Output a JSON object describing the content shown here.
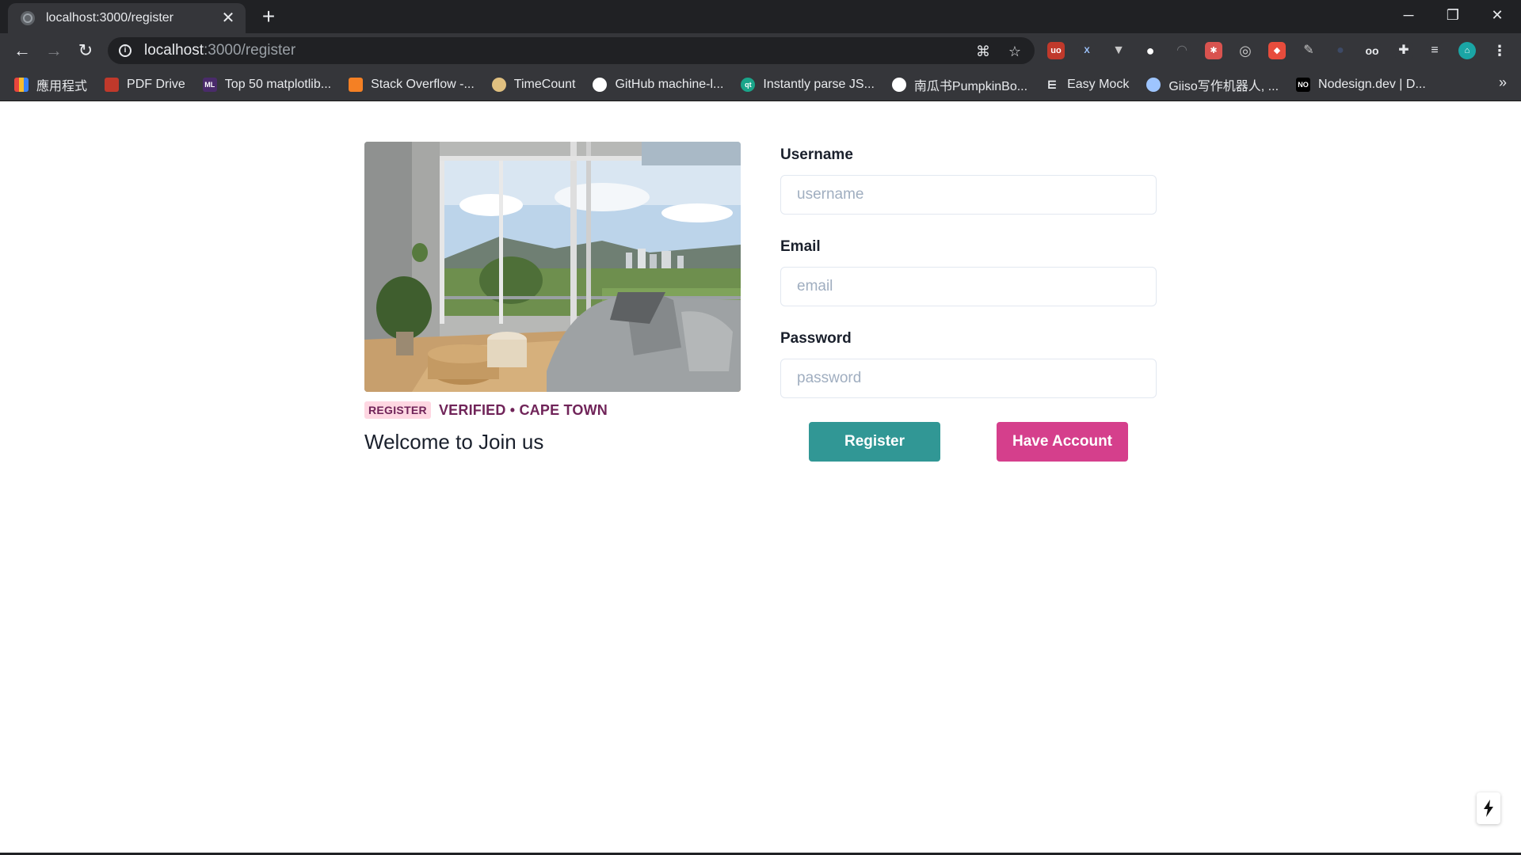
{
  "browser": {
    "tab_title": "localhost:3000/register",
    "url_host": "localhost",
    "url_path": ":3000/register",
    "bookmarks": [
      {
        "label": "應用程式",
        "icon": "apps-grid-icon",
        "color": "#e8453c"
      },
      {
        "label": "PDF Drive",
        "icon": "pdf-drive-icon",
        "color": "#c0392b"
      },
      {
        "label": "Top 50 matplotlib...",
        "icon": "ml-icon",
        "color": "#4a2b6b"
      },
      {
        "label": "Stack Overflow -...",
        "icon": "stackoverflow-icon",
        "color": "#f48024"
      },
      {
        "label": "TimeCount",
        "icon": "timecount-icon",
        "color": "#e0c080"
      },
      {
        "label": "GitHub machine-l...",
        "icon": "github-icon",
        "color": "#ffffff"
      },
      {
        "label": "Instantly parse JS...",
        "icon": "qt-icon",
        "color": "#1aa58a"
      },
      {
        "label": "南瓜书PumpkinBo...",
        "icon": "globe-icon",
        "color": "#ffffff"
      },
      {
        "label": "Easy Mock",
        "icon": "easy-mock-icon",
        "color": "#ffffff"
      },
      {
        "label": "Giiso写作机器人, ...",
        "icon": "giiso-icon",
        "color": "#9ec5ff"
      },
      {
        "label": "Nodesign.dev | D...",
        "icon": "nodesign-icon",
        "color": "#000000"
      }
    ],
    "bookmarks_more": "»"
  },
  "card": {
    "badge": "REGISTER",
    "meta": "VERIFIED • CAPE TOWN",
    "welcome": "Welcome to Join us",
    "image": "living-room-balcony-photo"
  },
  "form": {
    "username_label": "Username",
    "username_placeholder": "username",
    "email_label": "Email",
    "email_placeholder": "email",
    "password_label": "Password",
    "password_placeholder": "password",
    "register_button": "Register",
    "have_account_button": "Have Account"
  },
  "colors": {
    "teal": "#319795",
    "pink": "#d53f8c",
    "badge_bg": "#fed7e2",
    "badge_text": "#702459"
  }
}
